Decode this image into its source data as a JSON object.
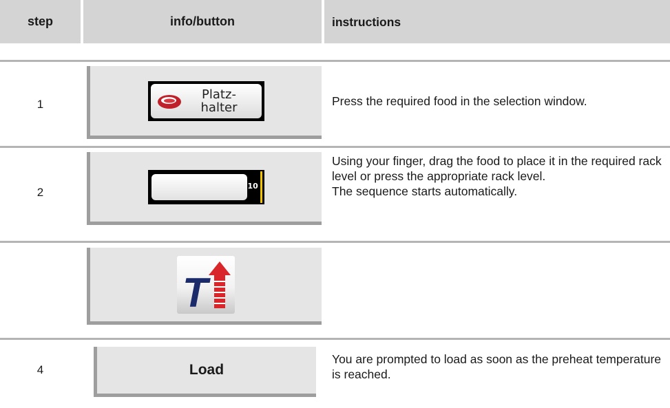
{
  "header": {
    "step": "step",
    "info": "info/button",
    "instructions": "instructions"
  },
  "rows": [
    {
      "step": "1",
      "button": {
        "type": "food-button",
        "label_line1": "Platz-",
        "label_line2": "halter",
        "icon": "meat-icon"
      },
      "instructions": [
        "Press the required food in the selection window."
      ]
    },
    {
      "step": "2",
      "button": {
        "type": "rack-level",
        "value": "10"
      },
      "instructions": [
        "Using your finger, drag the food to place it in the required rack level or press the appropriate rack level.",
        "The sequence starts automatically."
      ]
    },
    {
      "step": "",
      "button": {
        "type": "icon",
        "icon": "preheat-temperature-icon",
        "letter": "T"
      },
      "instructions": []
    },
    {
      "step": "4",
      "button": {
        "type": "label",
        "label": "Load"
      },
      "instructions": [
        "You are prompted to load as soon as the preheat temperature is reached."
      ]
    }
  ],
  "colors": {
    "header_bg": "#d4d4d4",
    "panel_bg": "#e5e5e5",
    "panel_shadow": "#9e9e9e",
    "rule": "#b4b4b4",
    "rack_indicator": "#f2c400",
    "icon_arrow": "#d8262b",
    "icon_letter": "#1b2a6b"
  }
}
